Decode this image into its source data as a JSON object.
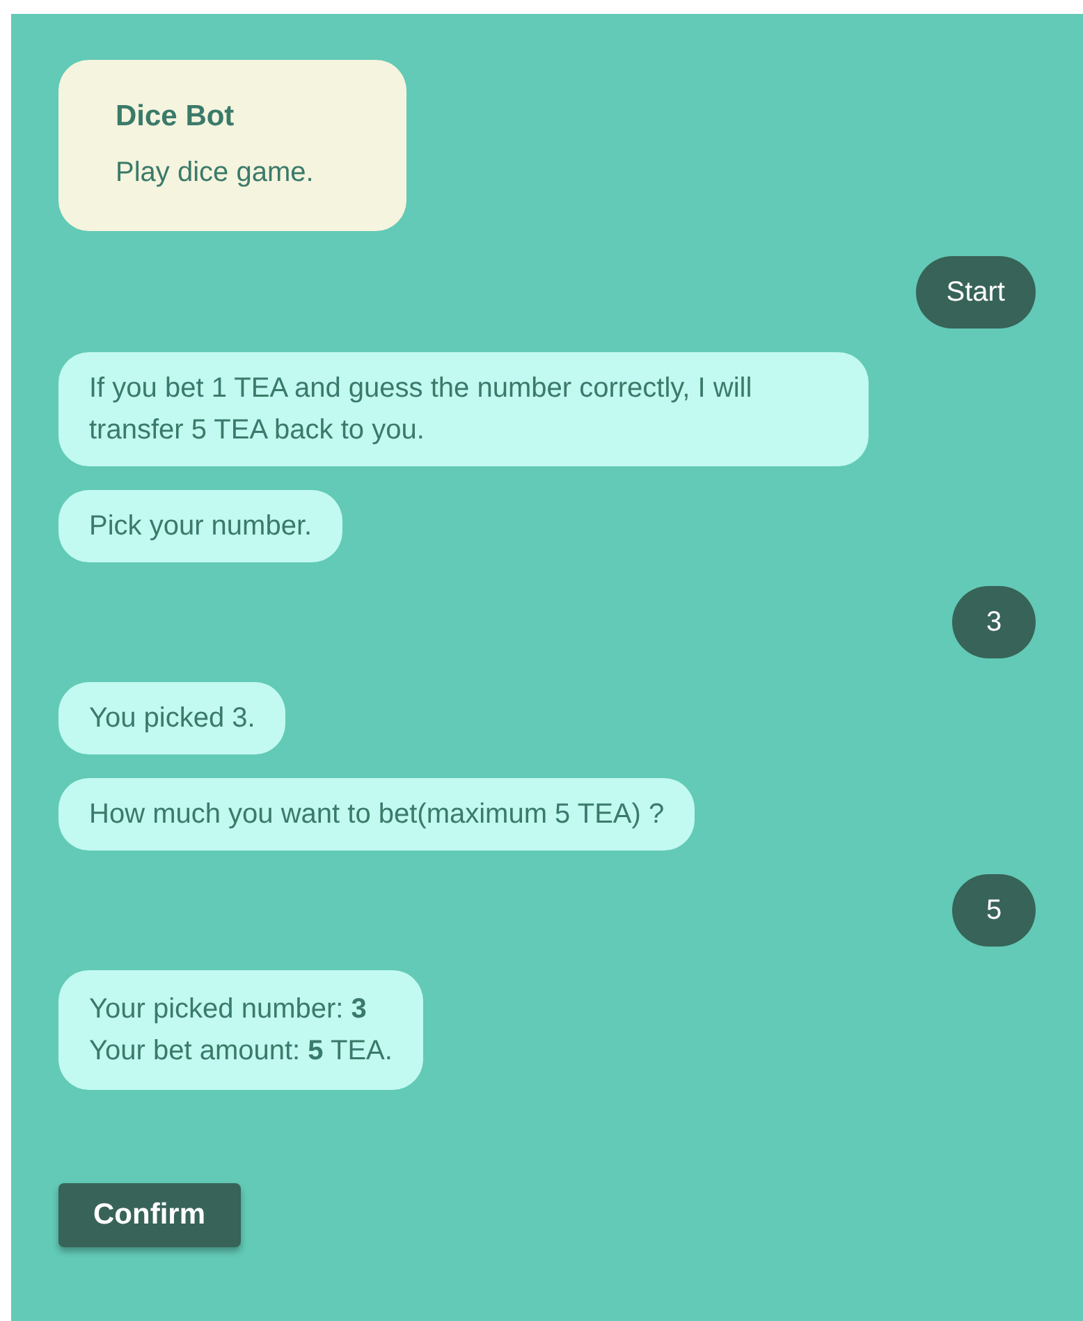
{
  "header": {
    "title": "Dice Bot",
    "subtitle": "Play dice game."
  },
  "messages": [
    {
      "kind": "user",
      "lines": [
        "Start"
      ]
    },
    {
      "kind": "bot",
      "lines": [
        "If you bet 1 TEA and guess the number correctly, I will transfer 5 TEA back to you."
      ]
    },
    {
      "kind": "bot",
      "lines": [
        "Pick your number."
      ]
    },
    {
      "kind": "user",
      "lines": [
        "3"
      ]
    },
    {
      "kind": "bot",
      "lines": [
        "You picked 3."
      ]
    },
    {
      "kind": "bot",
      "lines": [
        "How much you want to bet(maximum 5 TEA) ?"
      ]
    },
    {
      "kind": "user",
      "lines": [
        "5"
      ]
    },
    {
      "kind": "bot",
      "lines": [
        "Your picked number: **3**",
        "Your bet amount: **5** TEA."
      ]
    }
  ],
  "confirm_button": "Confirm"
}
